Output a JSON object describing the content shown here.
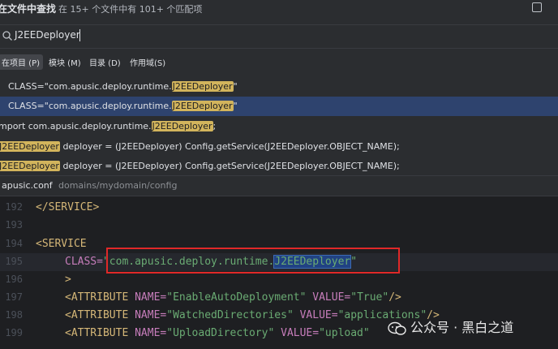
{
  "header": {
    "title": "在文件中查找",
    "subtitle": "在 15+ 个文件中有 101+ 个匹配项"
  },
  "search": {
    "value": "J2EEDeployer"
  },
  "scopes": [
    {
      "label": "在项目 (P)",
      "active": true
    },
    {
      "label": "模块 (M)",
      "active": false
    },
    {
      "label": "目录 (D)",
      "active": false
    },
    {
      "label": "作用域(S)",
      "active": false
    }
  ],
  "results": [
    {
      "prefix": "CLASS=\"com.apusic.deploy.runtime.",
      "match": "J2EEDeployer",
      "suffix": "\"",
      "selected": false
    },
    {
      "prefix": "CLASS=\"com.apusic.deploy.runtime.",
      "match": "J2EEDeployer",
      "suffix": "\"",
      "selected": true
    },
    {
      "prefix": "mport com.apusic.deploy.runtime.",
      "match": "J2EEDeployer",
      "suffix": ";",
      "selected": false
    },
    {
      "prefix": "",
      "match": "J2EEDeployer",
      "suffix": " deployer = (J2EEDeployer) Config.getService(J2EEDeployer.OBJECT_NAME);",
      "selected": false
    },
    {
      "prefix": "",
      "match": "J2EEDeployer",
      "suffix": " deployer = (J2EEDeployer) Config.getService(J2EEDeployer.OBJECT_NAME);",
      "selected": false
    }
  ],
  "file": {
    "name": "apusic.conf",
    "path": "domains/mydomain/config"
  },
  "editor": {
    "line_numbers": [
      "192",
      "193",
      "194",
      "195",
      "196",
      "197",
      "198",
      "199"
    ],
    "close_service": "</SERVICE>",
    "open_service": "<SERVICE",
    "class_attr": "CLASS=",
    "class_value_prefix": "\"com.apusic.deploy.runtime.",
    "class_value_match": "J2EEDeployer",
    "class_value_suffix": "\"",
    "gt": ">",
    "attr1_name": "EnableAutoDeployment",
    "attr1_value": "True",
    "attr2_name": "WatchedDirectories",
    "attr2_value": "applications",
    "attr3_name": "UploadDirectory",
    "attr3_value": "upload",
    "last_line": "</SERVICE>"
  },
  "watermark": "公众号 · 黑白之道",
  "colors": {
    "highlight": "#d2b45c",
    "selection": "#2e436e",
    "annotation_box": "#e02828"
  }
}
